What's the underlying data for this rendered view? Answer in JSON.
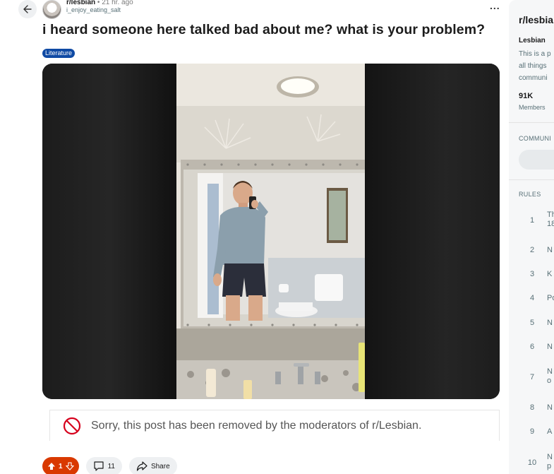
{
  "post": {
    "subreddit": "r/lesbian",
    "separator": "•",
    "time": "21 hr. ago",
    "username": "i_enjoy_eating_salt",
    "more_label": "...",
    "title": "i heard someone here talked bad about me? what is your problem?",
    "flair": "Literature",
    "removed_notice": "Sorry, this post has been removed by the moderators of r/Lesbian.",
    "vote_count": "1",
    "comment_count": "11",
    "share_label": "Share"
  },
  "colors": {
    "upvote_active": "#d93900",
    "flair_bg": "#0f4aa4",
    "removed_icon": "#d6001c"
  },
  "icons": [
    "back-arrow-icon",
    "more-icon",
    "removed-icon",
    "upvote-icon",
    "downvote-icon",
    "comment-icon",
    "share-icon"
  ],
  "sidebar": {
    "name": "r/lesbia",
    "subtitle": "Lesbian",
    "description_lines": [
      "This is a p",
      "all things",
      "communi"
    ],
    "members": "91K",
    "members_label": "Members",
    "community_header": "COMMUNI",
    "rules_header": "RULES",
    "rules": [
      {
        "n": "1",
        "t": "Th",
        "t2": "18"
      },
      {
        "n": "2",
        "t": "N",
        "t2": ""
      },
      {
        "n": "3",
        "t": "K",
        "t2": ""
      },
      {
        "n": "4",
        "t": "Po",
        "t2": ""
      },
      {
        "n": "5",
        "t": "N",
        "t2": ""
      },
      {
        "n": "6",
        "t": "N",
        "t2": ""
      },
      {
        "n": "7",
        "t": "N",
        "t2": "o"
      },
      {
        "n": "8",
        "t": "N",
        "t2": ""
      },
      {
        "n": "9",
        "t": "A",
        "t2": ""
      },
      {
        "n": "10",
        "t": "N",
        "t2": "p"
      }
    ]
  }
}
